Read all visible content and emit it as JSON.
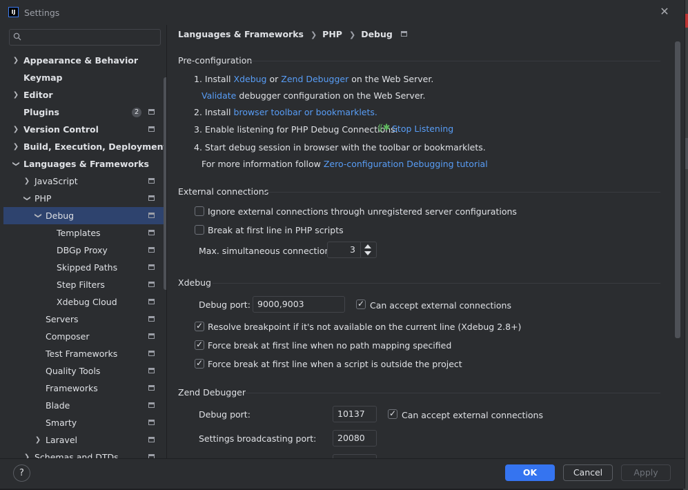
{
  "window": {
    "title": "Settings",
    "logo_text": "IJ"
  },
  "search": {
    "placeholder": ""
  },
  "sidebar": {
    "items": [
      {
        "label": "Appearance & Behavior"
      },
      {
        "label": "Keymap"
      },
      {
        "label": "Editor"
      },
      {
        "label": "Plugins",
        "badge": "2"
      },
      {
        "label": "Version Control"
      },
      {
        "label": "Build, Execution, Deployment"
      },
      {
        "label": "Languages & Frameworks"
      },
      {
        "label": "JavaScript"
      },
      {
        "label": "PHP"
      },
      {
        "label": "Debug"
      },
      {
        "label": "Templates"
      },
      {
        "label": "DBGp Proxy"
      },
      {
        "label": "Skipped Paths"
      },
      {
        "label": "Step Filters"
      },
      {
        "label": "Xdebug Cloud"
      },
      {
        "label": "Servers"
      },
      {
        "label": "Composer"
      },
      {
        "label": "Test Frameworks"
      },
      {
        "label": "Quality Tools"
      },
      {
        "label": "Frameworks"
      },
      {
        "label": "Blade"
      },
      {
        "label": "Smarty"
      },
      {
        "label": "Laravel"
      },
      {
        "label": "Schemas and DTDs"
      }
    ]
  },
  "breadcrumb": [
    "Languages & Frameworks",
    "PHP",
    "Debug"
  ],
  "preconfig": {
    "title": "Pre-configuration",
    "step1_prefix": "1. Install",
    "xdebug_link": "Xdebug",
    "or_text": "or",
    "zend_link": "Zend Debugger",
    "step1_suffix": "on the Web Server.",
    "validate_link": "Validate",
    "validate_suffix": "debugger configuration on the Web Server.",
    "step2_prefix": "2. Install",
    "toolbar_link": "browser toolbar or bookmarklets.",
    "step3_text": "3. Enable listening for PHP Debug Connections:",
    "stop_listening_link": "Stop Listening",
    "step4_text": "4. Start debug session in browser with the toolbar or bookmarklets.",
    "more_info_prefix": "For more information follow",
    "tutorial_link": "Zero-configuration Debugging tutorial"
  },
  "external": {
    "title": "External connections",
    "ignore_label": "Ignore external connections through unregistered server configurations",
    "ignore_checked": false,
    "break_label": "Break at first line in PHP scripts",
    "break_checked": false,
    "max_label": "Max. simultaneous connections:",
    "max_value": "3"
  },
  "xdebug": {
    "title": "Xdebug",
    "port_label": "Debug port:",
    "port_value": "9000,9003",
    "accept_label": "Can accept external connections",
    "accept_checked": true,
    "resolve_label": "Resolve breakpoint if it's not available on the current line (Xdebug 2.8+)",
    "force_nopath_label": "Force break at first line when no path mapping specified",
    "force_outside_label": "Force break at first line when a script is outside the project"
  },
  "zend": {
    "title": "Zend Debugger",
    "port_label": "Debug port:",
    "port_value": "10137",
    "accept_label": "Can accept external connections",
    "broadcast_label": "Settings broadcasting port:",
    "broadcast_value": "20080"
  },
  "footer": {
    "help_label": "?",
    "ok_label": "OK",
    "cancel_label": "Cancel",
    "apply_label": "Apply"
  },
  "colors": {
    "accent": "#3574f0",
    "link": "#589df6",
    "selection": "#2e436e"
  }
}
